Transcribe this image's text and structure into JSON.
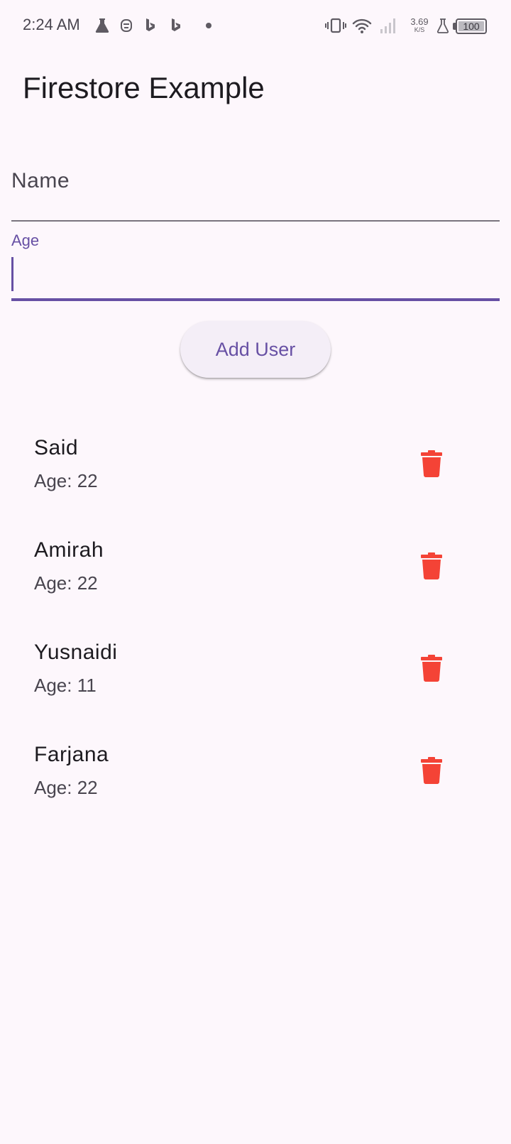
{
  "status_bar": {
    "time": "2:24 AM",
    "icons_left": [
      "flask-icon",
      "android-face-icon",
      "bing-icon",
      "bing-icon",
      "dot-icon"
    ],
    "icons_right": [
      "vibrate-icon",
      "wifi-icon",
      "signal-icon",
      "lab-icon",
      "battery-icon"
    ],
    "net_speed_value": "3.69",
    "net_speed_unit": "K/S",
    "battery_level": "100"
  },
  "app_bar": {
    "title": "Firestore Example"
  },
  "form": {
    "name_label": "Name",
    "name_value": "",
    "age_label": "Age",
    "age_value": "",
    "add_button_label": "Add User"
  },
  "users": [
    {
      "name": "Said",
      "age": "Age: 22"
    },
    {
      "name": "Amirah",
      "age": "Age: 22"
    },
    {
      "name": "Yusnaidi",
      "age": "Age: 11"
    },
    {
      "name": "Farjana",
      "age": "Age: 22"
    }
  ],
  "colors": {
    "background": "#fdf7fc",
    "primary": "#6750a4",
    "delete": "#f44336",
    "text": "#1d1b20",
    "secondary_text": "#49454f"
  }
}
